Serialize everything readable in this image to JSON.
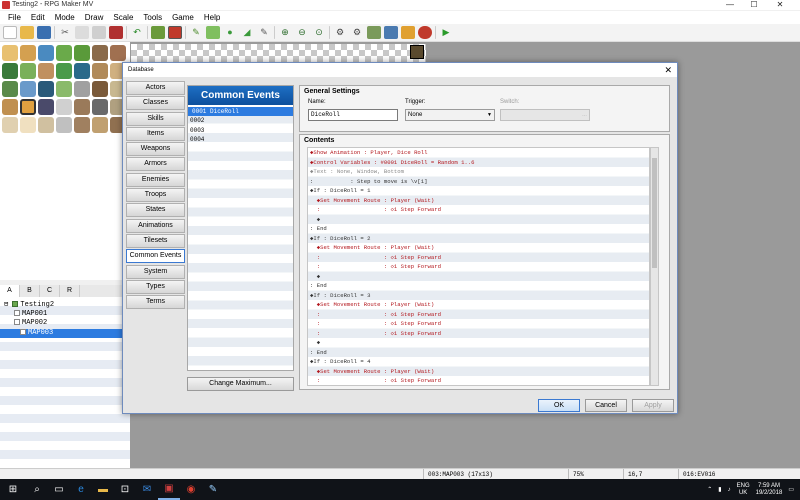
{
  "window": {
    "title": "Testing2 - RPG Maker MV",
    "minimize": "—",
    "maximize": "☐",
    "close": "✕"
  },
  "menu": [
    "File",
    "Edit",
    "Mode",
    "Draw",
    "Scale",
    "Tools",
    "Game",
    "Help"
  ],
  "palette_tabs": [
    "A",
    "B",
    "C",
    "R"
  ],
  "map_tree": {
    "project": "Testing2",
    "maps": [
      "MAP001",
      "MAP002",
      "MAP003"
    ],
    "selected_index": 2
  },
  "status": {
    "map": "003:MAP003 (17x13)",
    "zoom": "75%",
    "coords": "16,7",
    "event": "016:EV016"
  },
  "tray": {
    "lang": "ENG",
    "region": "UK",
    "time": "7:59 AM",
    "date": "19/2/2018"
  },
  "database": {
    "title": "Database",
    "close": "✕",
    "categories": [
      "Actors",
      "Classes",
      "Skills",
      "Items",
      "Weapons",
      "Armors",
      "Enemies",
      "Troops",
      "States",
      "Animations",
      "Tilesets",
      "Common Events",
      "System",
      "Types",
      "Terms"
    ],
    "active_category": "Common Events",
    "common_events": {
      "header": "Common Events",
      "items": [
        "0001 DiceRoll",
        "0002",
        "0003",
        "0004"
      ],
      "change_max": "Change Maximum..."
    },
    "general": {
      "title": "General Settings",
      "name_label": "Name:",
      "name_value": "DiceRoll",
      "trigger_label": "Trigger:",
      "trigger_value": "None",
      "switch_label": "Switch:",
      "switch_value": ""
    },
    "contents": {
      "title": "Contents",
      "lines": [
        {
          "t": "◆Show Animation : Player, Dice Roll",
          "c": "red"
        },
        {
          "t": "◆Control Variables : #0001 DiceRoll = Random 1..6",
          "c": "red"
        },
        {
          "t": "◆Text : None, Window, Bottom",
          "c": "gray"
        },
        {
          "t": ":           : Step to move is \\v[1]",
          "c": "dk"
        },
        {
          "t": "◆If : DiceRoll = 1",
          "c": "dk"
        },
        {
          "t": "  ◆Set Movement Route : Player (Wait)",
          "c": "red"
        },
        {
          "t": "  :                   : ◇1 Step Forward",
          "c": "red"
        },
        {
          "t": "  ◆",
          "c": "dk"
        },
        {
          "t": ": End",
          "c": "dk"
        },
        {
          "t": "◆If : DiceRoll = 2",
          "c": "dk"
        },
        {
          "t": "  ◆Set Movement Route : Player (Wait)",
          "c": "red"
        },
        {
          "t": "  :                   : ◇1 Step Forward",
          "c": "red"
        },
        {
          "t": "  :                   : ◇1 Step Forward",
          "c": "red"
        },
        {
          "t": "  ◆",
          "c": "dk"
        },
        {
          "t": ": End",
          "c": "dk"
        },
        {
          "t": "◆If : DiceRoll = 3",
          "c": "dk"
        },
        {
          "t": "  ◆Set Movement Route : Player (Wait)",
          "c": "red"
        },
        {
          "t": "  :                   : ◇1 Step Forward",
          "c": "red"
        },
        {
          "t": "  :                   : ◇1 Step Forward",
          "c": "red"
        },
        {
          "t": "  :                   : ◇1 Step Forward",
          "c": "red"
        },
        {
          "t": "  ◆",
          "c": "dk"
        },
        {
          "t": ": End",
          "c": "dk"
        },
        {
          "t": "◆If : DiceRoll = 4",
          "c": "dk"
        },
        {
          "t": "  ◆Set Movement Route : Player (Wait)",
          "c": "red"
        },
        {
          "t": "  :                   : ◇1 Step Forward",
          "c": "red"
        }
      ]
    },
    "buttons": {
      "ok": "OK",
      "cancel": "Cancel",
      "apply": "Apply"
    }
  }
}
